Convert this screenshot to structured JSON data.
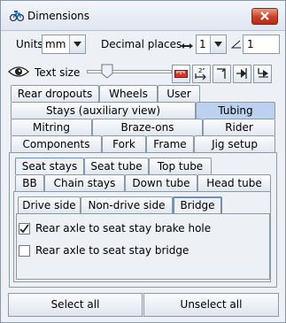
{
  "window": {
    "title": "Dimensions"
  },
  "toolbar": {
    "units_label": "Units",
    "units_value": "mm",
    "decimal_label": "Decimal places",
    "decimal_value": "1",
    "angle_value": "1",
    "textsize_label": "Text size",
    "textsize_level": 0.2
  },
  "tabs": {
    "row1": [
      "Rear dropouts",
      "Wheels",
      "User"
    ],
    "row2": [
      "Stays (auxiliary view)",
      "Tubing"
    ],
    "row3": [
      "Mitring",
      "Braze-ons",
      "Rider"
    ],
    "row4": [
      "Components",
      "Fork",
      "Frame",
      "Jig setup"
    ],
    "selected": "Tubing"
  },
  "subtabs": {
    "row1": [
      "Seat stays",
      "Seat tube",
      "Top tube"
    ],
    "row2": [
      "BB",
      "Chain stays",
      "Down tube",
      "Head tube"
    ],
    "selected": "Seat stays"
  },
  "subsubtabs": {
    "items": [
      "Drive side",
      "Non-drive side",
      "Bridge"
    ],
    "selected": "Bridge"
  },
  "options": [
    {
      "label": "Rear axle to seat stay brake hole",
      "checked": true
    },
    {
      "label": "Rear axle to seat stay bridge",
      "checked": false
    }
  ],
  "buttons": {
    "select_all": "Select all",
    "unselect_all": "Unselect all"
  }
}
